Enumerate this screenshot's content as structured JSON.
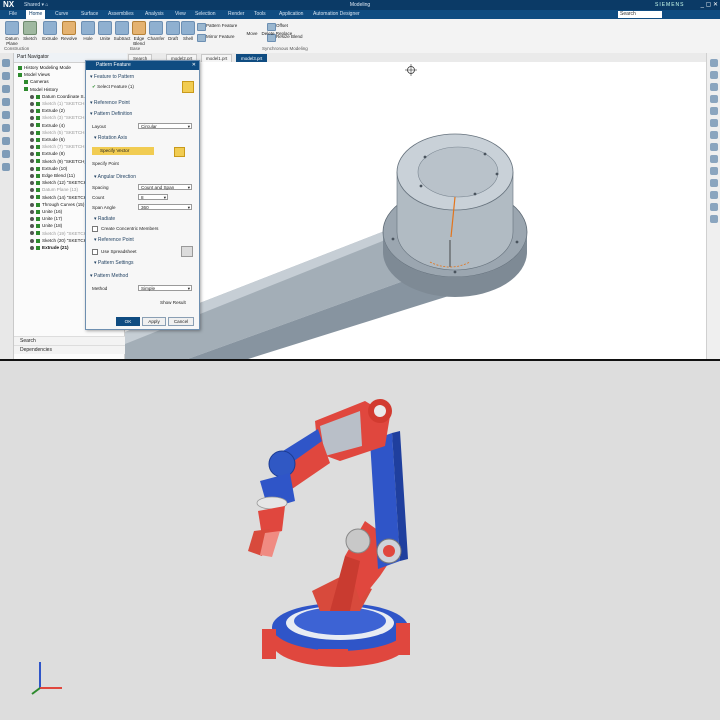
{
  "app": {
    "logo": "NX",
    "quick_access": "Shared ▾ ⌂",
    "title": "Modeling",
    "brand": "SIEMENS",
    "window_controls": "_ ▢ ✕"
  },
  "menu": {
    "tabs": [
      "File",
      "Home",
      "Curve",
      "Surface",
      "Assemblies",
      "Analysis",
      "View",
      "Selection",
      "Render",
      "Tools",
      "Application",
      "Automation Designer"
    ],
    "active_tab": "Home",
    "search_placeholder": "Search"
  },
  "ribbon": {
    "buttons": [
      "Datum Plane",
      "Sketch",
      "Extrude",
      "Revolve",
      "Hole",
      "Unite",
      "Subtract",
      "Edge Blend",
      "Chamfer",
      "Draft",
      "Shell"
    ],
    "small_buttons": [
      "Pattern Feature",
      "Mirror Feature",
      "Offset",
      "Resize Blend"
    ],
    "right_buttons": [
      "Move",
      "Delete",
      "Replace"
    ],
    "groups": [
      "Construction",
      "Base",
      "Synchronous Modeling"
    ]
  },
  "file_tabs": [
    "Search",
    "model2.prt",
    "model1.prt",
    "model3.prt"
  ],
  "active_file_tab": "model3.prt",
  "navigator": {
    "title": "Part Navigator",
    "items": [
      {
        "label": "History Modeling Mode",
        "state": "normal"
      },
      {
        "label": "Model Views",
        "state": "normal"
      },
      {
        "label": "Cameras",
        "state": "normal"
      },
      {
        "label": "Model History",
        "state": "normal"
      },
      {
        "label": "Datum Coordinate S...",
        "state": "normal"
      },
      {
        "label": "Sketch (1) \"SKETCH...",
        "state": "dim"
      },
      {
        "label": "Extrude (2)",
        "state": "normal"
      },
      {
        "label": "Sketch (3) \"SKETCH...",
        "state": "dim"
      },
      {
        "label": "Extrude (4)",
        "state": "normal"
      },
      {
        "label": "Sketch (5) \"SKETCH...",
        "state": "dim"
      },
      {
        "label": "Extrude (6)",
        "state": "normal"
      },
      {
        "label": "Sketch (7) \"SKETCH...",
        "state": "dim"
      },
      {
        "label": "Extrude (8)",
        "state": "normal"
      },
      {
        "label": "Sketch (9) \"SKETCH_0...",
        "state": "normal"
      },
      {
        "label": "Extrude (10)",
        "state": "normal"
      },
      {
        "label": "Edge Blend (11)",
        "state": "normal"
      },
      {
        "label": "Sketch (12) \"SKETCH...",
        "state": "normal"
      },
      {
        "label": "Datum Plane (13)",
        "state": "dim"
      },
      {
        "label": "Sketch (14) \"SKETCH...",
        "state": "normal"
      },
      {
        "label": "Through Curves (15)",
        "state": "normal"
      },
      {
        "label": "Unite (16)",
        "state": "normal"
      },
      {
        "label": "Unite (17)",
        "state": "normal"
      },
      {
        "label": "Unite (18)",
        "state": "normal"
      },
      {
        "label": "Sketch (19) \"SKETCH...",
        "state": "dim"
      },
      {
        "label": "Sketch (20) \"SKETCH...",
        "state": "normal"
      },
      {
        "label": "Extrude (21)",
        "state": "bold"
      }
    ],
    "footer": [
      "Search",
      "Dependencies"
    ]
  },
  "dialog": {
    "title": "Pattern Feature",
    "close": "✕",
    "sections": {
      "features": "Feature to Pattern",
      "ref_point": "Reference Point",
      "definition": "Pattern Definition",
      "rotation_axis": "Rotation Axis",
      "angular": "Angular Direction",
      "radiate": "Radiate",
      "ref_point2": "Reference Point",
      "settings": "Pattern Settings",
      "method": "Pattern Method"
    },
    "select_feature": "Select Feature (1)",
    "layout_label": "Layout",
    "layout_value": "Circular",
    "specify_vector": "Specify Vector",
    "specify_point": "Specify Point",
    "spacing_label": "Spacing",
    "spacing_value": "Count and Span",
    "count_label": "Count",
    "count_value": "8",
    "span_label": "Span Angle",
    "span_value": "360",
    "create_concentric": "Create Concentric Members",
    "use_spreadsheet": "Use Spreadsheet",
    "method_label": "Method",
    "method_value": "Simple",
    "show_result": "Show Result",
    "ok": "OK",
    "apply": "Apply",
    "cancel": "Cancel"
  },
  "colors": {
    "accent": "#0f4c81",
    "robot_red": "#e0473e",
    "robot_blue": "#2f55c8",
    "part_gray": "#a9b4bd"
  }
}
